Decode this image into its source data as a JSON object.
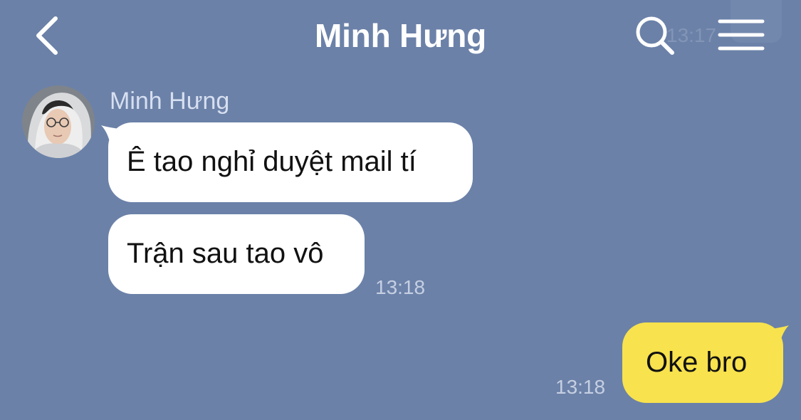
{
  "header": {
    "title": "Minh Hưng",
    "back_icon": "chevron-left-icon",
    "search_icon": "search-icon",
    "menu_icon": "hamburger-menu-icon",
    "ghost_time": "13:17"
  },
  "messages": {
    "received": {
      "sender_name": "Minh Hưng",
      "avatar": "profile-photo",
      "items": [
        {
          "text": "Ê tao nghỉ duyệt mail tí"
        },
        {
          "text": "Trận sau tao vô",
          "time": "13:18"
        }
      ]
    },
    "sent": {
      "items": [
        {
          "text": "Oke bro",
          "time": "13:18"
        }
      ]
    }
  },
  "colors": {
    "background": "#6b81a8",
    "incoming_bubble": "#ffffff",
    "outgoing_bubble": "#f8e24d",
    "header_text": "#ffffff",
    "timestamp": "#c6cfe2"
  }
}
